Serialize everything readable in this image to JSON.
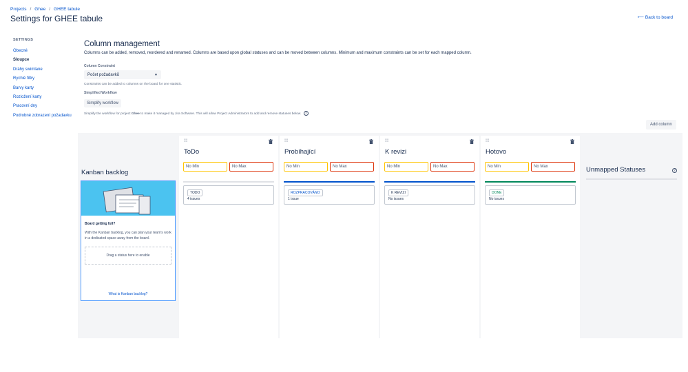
{
  "breadcrumb": [
    "Projects",
    "Ghee",
    "GHEE tabule"
  ],
  "page_title": "Settings for GHEE tabule",
  "back_link": "Back to board",
  "sidebar": {
    "heading": "SETTINGS",
    "items": [
      {
        "label": "Obecné"
      },
      {
        "label": "Sloupce"
      },
      {
        "label": "Dráhy swimlane"
      },
      {
        "label": "Rychlé filtry"
      },
      {
        "label": "Barvy karty"
      },
      {
        "label": "Rozložení karty"
      },
      {
        "label": "Pracovní dny"
      },
      {
        "label": "Podrobné zobrazení požadavku"
      }
    ]
  },
  "main": {
    "title": "Column management",
    "description": "Columns can be added, removed, reordered and renamed. Columns are based upon global statuses and can be moved between columns. Minimum and maximum constraints can be set for each mapped column.",
    "constraint_label": "Column Constraint",
    "constraint_value": "Počet požadavků",
    "constraint_hint": "Constraints can be added to columns on the board for one statistic.",
    "workflow_label": "Simplified Workflow",
    "workflow_button": "Simplify workflow",
    "workflow_hint_pre": "Simplify the workflow for project ",
    "workflow_hint_project": "Ghee",
    "workflow_hint_post": " to make it managed by Jira Software. This will allow Project Administrators to add and remove statuses below.",
    "help_glyph": "?",
    "add_column": "Add column"
  },
  "backlog": {
    "title": "Kanban backlog",
    "card_title": "Board getting full?",
    "card_text": "With the Kanban backlog, you can plan your team's work in a dedicated space away from the board.",
    "dropzone": "Drag a status here to enable",
    "link": "What is Kanban backlog?"
  },
  "columns": [
    {
      "name": "ToDo",
      "min": "No Min",
      "max": "No Max",
      "status": "TODO",
      "issues": "4 issues",
      "bar_color": "#dfe1e6"
    },
    {
      "name": "Probíhající",
      "min": "No Min",
      "max": "No Max",
      "status": "ROZPRACOVÁNO",
      "issues": "1 issue",
      "bar_color": "#0052cc"
    },
    {
      "name": "K revizi",
      "min": "No Min",
      "max": "No Max",
      "status": "K REVIZI",
      "issues": "No issues",
      "bar_color": "#0052cc"
    },
    {
      "name": "Hotovo",
      "min": "No Min",
      "max": "No Max",
      "status": "DONE",
      "issues": "No issues",
      "bar_color": "#00875a"
    }
  ],
  "unmapped": {
    "title": "Unmapped Statuses"
  },
  "colors": {
    "link": "#0052cc",
    "min_border": "#ffc400",
    "max_border": "#de350b"
  }
}
